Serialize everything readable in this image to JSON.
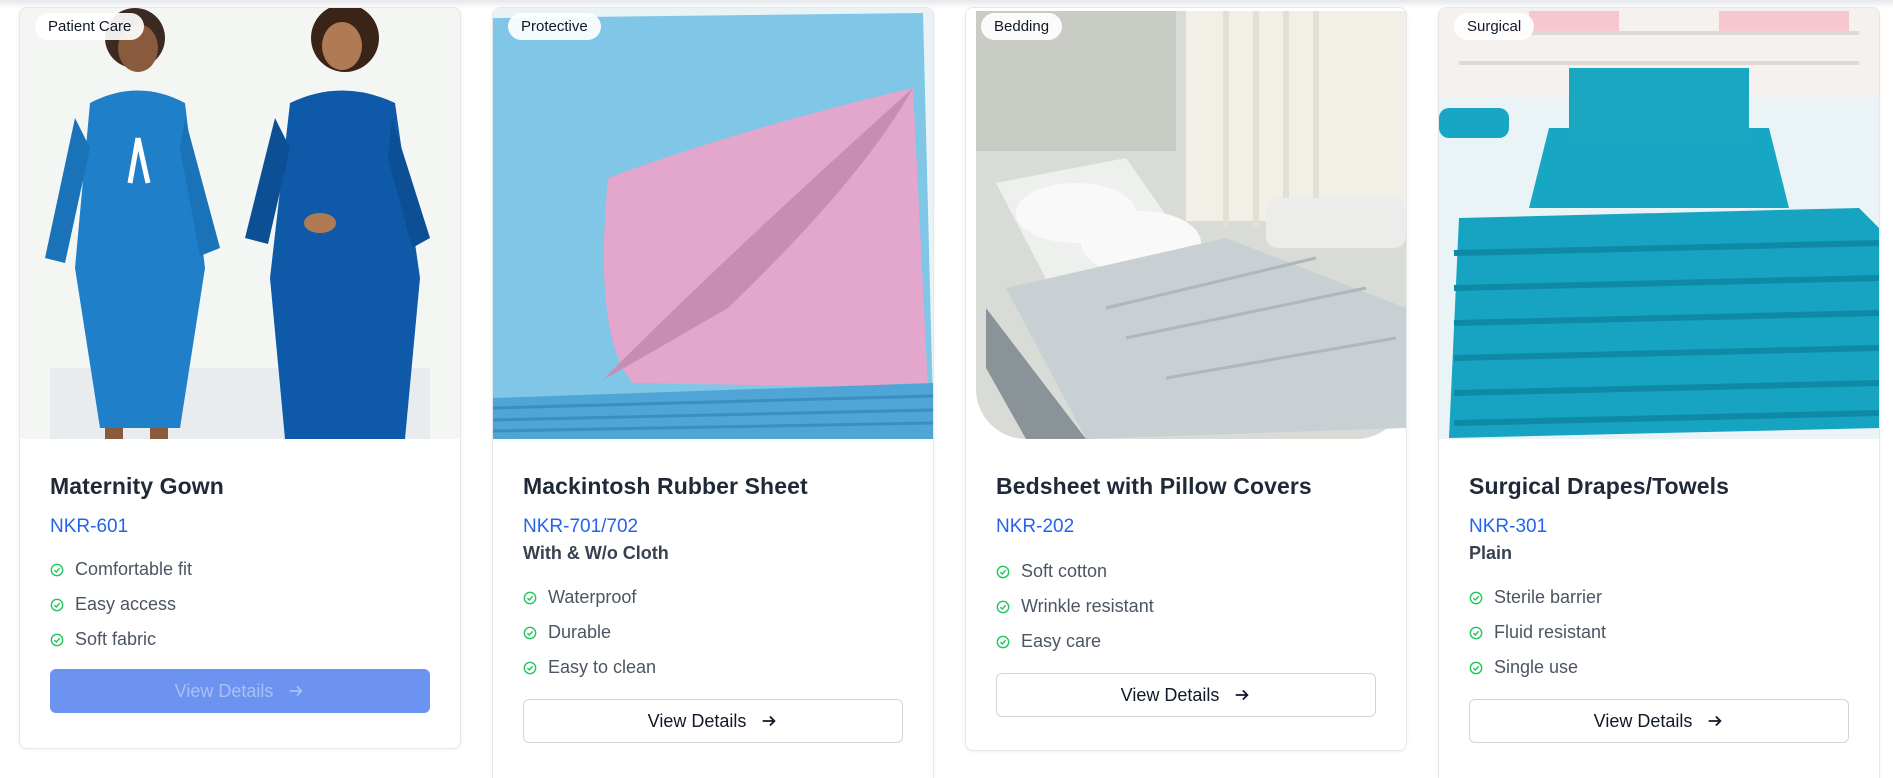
{
  "products": [
    {
      "category": "Patient Care",
      "name": "Maternity Gown",
      "code": "NKR-601",
      "subtitle": "",
      "features": [
        "Comfortable fit",
        "Easy access",
        "Soft fabric"
      ],
      "button_label": "View Details",
      "image_colors": {
        "primary": "#1f7fc9",
        "secondary": "#0f5aa8",
        "background": "#e8f1ec"
      }
    },
    {
      "category": "Protective",
      "name": "Mackintosh Rubber Sheet",
      "code": "NKR-701/702",
      "subtitle": "With & W/o Cloth",
      "features": [
        "Waterproof",
        "Durable",
        "Easy to clean"
      ],
      "button_label": "View Details",
      "image_colors": {
        "primary": "#7cc4e6",
        "secondary": "#e3a6cc"
      }
    },
    {
      "category": "Bedding",
      "name": "Bedsheet with Pillow Covers",
      "code": "NKR-202",
      "subtitle": "",
      "features": [
        "Soft cotton",
        "Wrinkle resistant",
        "Easy care"
      ],
      "button_label": "View Details",
      "image_colors": {
        "primary": "#c9d0d3",
        "secondary": "#8a9398"
      }
    },
    {
      "category": "Surgical",
      "name": "Surgical Drapes/Towels",
      "code": "NKR-301",
      "subtitle": "Plain",
      "features": [
        "Sterile barrier",
        "Fluid resistant",
        "Single use"
      ],
      "button_label": "View Details",
      "image_colors": {
        "primary": "#17a6c3",
        "secondary": "#0e8aa6"
      }
    }
  ],
  "colors": {
    "accent": "#2563eb",
    "check": "#22c55e"
  }
}
